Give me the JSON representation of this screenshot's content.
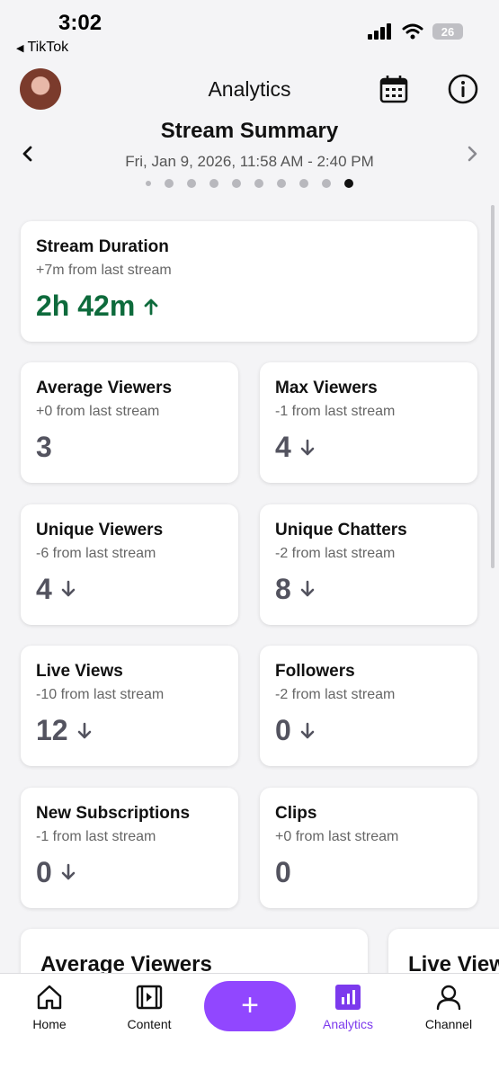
{
  "status_bar": {
    "time": "3:02",
    "back_app": "TikTok",
    "battery": "26"
  },
  "header": {
    "title": "Analytics"
  },
  "summary": {
    "title": "Stream Summary",
    "date_range": "Fri, Jan 9, 2026, 11:58 AM - 2:40 PM",
    "page_count": 10,
    "active_page": 10
  },
  "stream_duration": {
    "title": "Stream Duration",
    "comparison": "+7m from last stream",
    "value": "2h 42m",
    "trend": "up"
  },
  "stats": [
    {
      "title": "Average Viewers",
      "comparison": "+0 from last stream",
      "value": "3",
      "trend": "none"
    },
    {
      "title": "Max Viewers",
      "comparison": "-1 from last stream",
      "value": "4",
      "trend": "down"
    },
    {
      "title": "Unique Viewers",
      "comparison": "-6 from last stream",
      "value": "4",
      "trend": "down"
    },
    {
      "title": "Unique Chatters",
      "comparison": "-2 from last stream",
      "value": "8",
      "trend": "down"
    },
    {
      "title": "Live Views",
      "comparison": "-10 from last stream",
      "value": "12",
      "trend": "down"
    },
    {
      "title": "Followers",
      "comparison": "-2 from last stream",
      "value": "0",
      "trend": "down"
    },
    {
      "title": "New Subscriptions",
      "comparison": "-1 from last stream",
      "value": "0",
      "trend": "down"
    },
    {
      "title": "Clips",
      "comparison": "+0 from last stream",
      "value": "0",
      "trend": "none"
    }
  ],
  "charts_row": {
    "first_title": "Average Viewers",
    "second_title": "Live Views"
  },
  "tabbar": {
    "home": "Home",
    "content": "Content",
    "create": "+",
    "analytics": "Analytics",
    "channel": "Channel"
  },
  "colors": {
    "accent": "#9147ff",
    "active_tab": "#7c3aed",
    "positive": "#0e6b3c",
    "value": "#53535f"
  }
}
